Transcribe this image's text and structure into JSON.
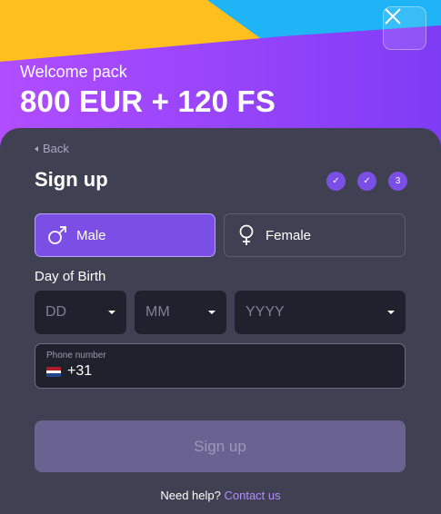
{
  "promo": {
    "subtitle": "Welcome pack",
    "amount": "800 EUR + 120 FS"
  },
  "close_button": {
    "icon": "close-icon"
  },
  "form": {
    "back_label": "Back",
    "title": "Sign up",
    "steps": [
      "✓",
      "✓",
      "3"
    ],
    "gender": {
      "male_label": "Male",
      "female_label": "Female",
      "selected": "Male"
    },
    "dob": {
      "label": "Day of Birth",
      "day_placeholder": "DD",
      "month_placeholder": "MM",
      "year_placeholder": "YYYY"
    },
    "phone": {
      "label": "Phone number",
      "country_code": "+31",
      "flag_icon": "netherlands-flag-icon"
    },
    "submit_label": "Sign up",
    "help_text": "Need help?",
    "contact_link": "Contact us"
  },
  "colors": {
    "accent": "#7b4fe6",
    "panel_bg": "#3f4152",
    "input_bg": "#1f212c",
    "link": "#b48cff",
    "submit_disabled": "#6a6391"
  }
}
